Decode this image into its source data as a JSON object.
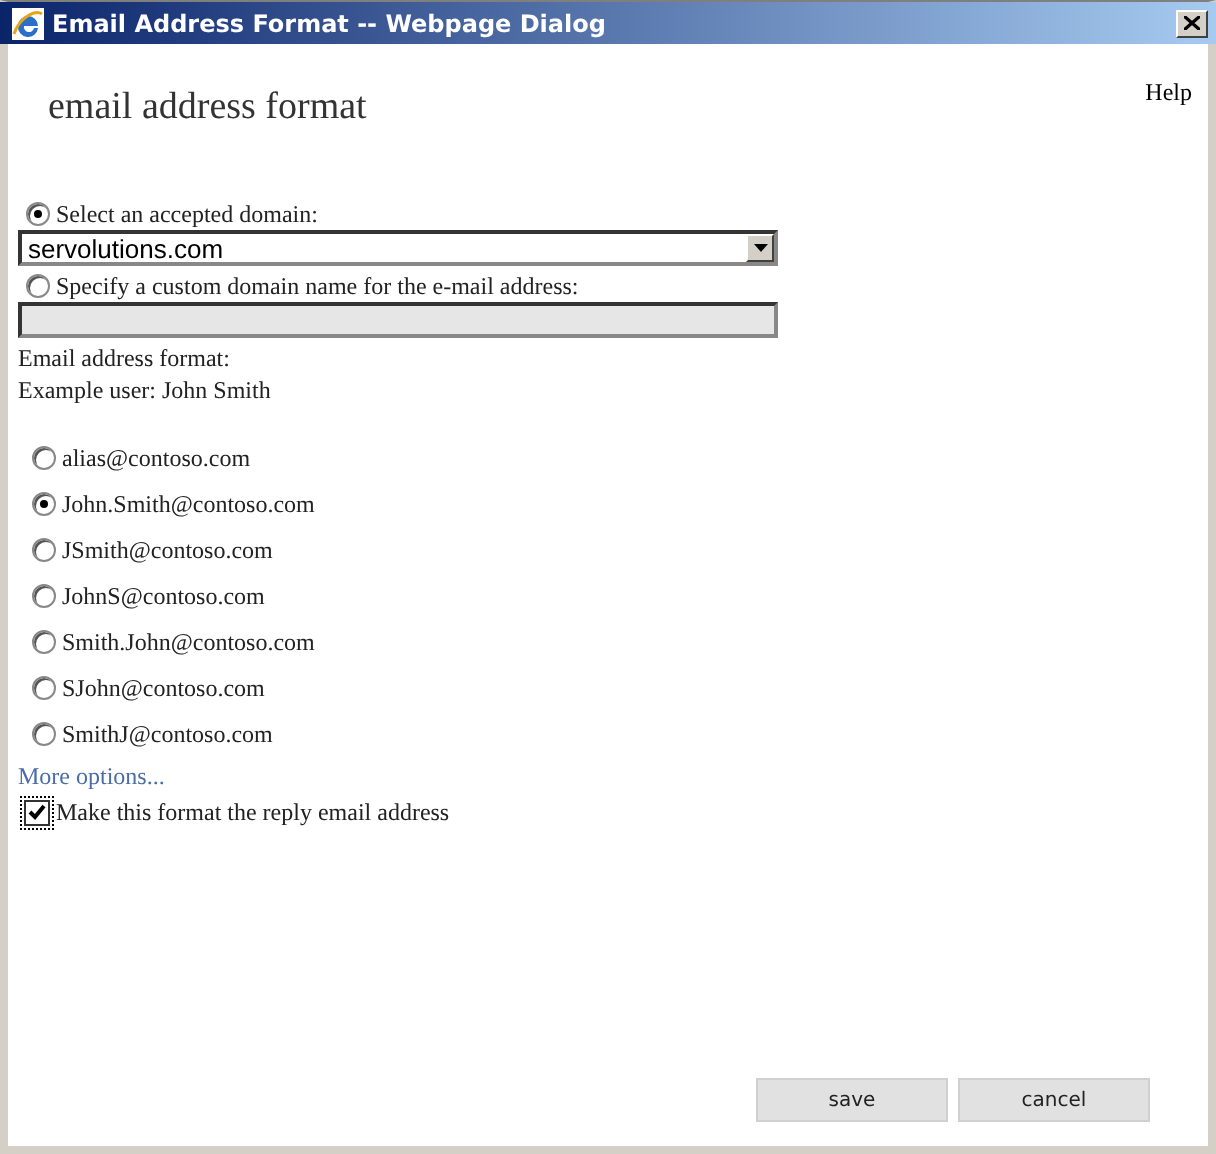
{
  "window": {
    "title": "Email Address Format -- Webpage Dialog",
    "help": "Help"
  },
  "heading": "email address format",
  "domain_choices": [
    {
      "label": "Select an accepted domain:",
      "selected": true,
      "kind": "select",
      "value": "servolutions.com"
    },
    {
      "label": "Specify a custom domain name for the e-mail address:",
      "selected": false,
      "kind": "text"
    }
  ],
  "format_label": "Email address format:",
  "example_user": "Example user: John Smith",
  "formats": [
    {
      "label": "alias@contoso.com",
      "selected": false
    },
    {
      "label": "John.Smith@contoso.com",
      "selected": true
    },
    {
      "label": "JSmith@contoso.com",
      "selected": false
    },
    {
      "label": "JohnS@contoso.com",
      "selected": false
    },
    {
      "label": "Smith.John@contoso.com",
      "selected": false
    },
    {
      "label": "SJohn@contoso.com",
      "selected": false
    },
    {
      "label": "SmithJ@contoso.com",
      "selected": false
    }
  ],
  "more_options": "More options...",
  "reply_checkbox": {
    "label": "Make this format the reply email address",
    "checked": true
  },
  "buttons": [
    "save",
    "cancel"
  ]
}
